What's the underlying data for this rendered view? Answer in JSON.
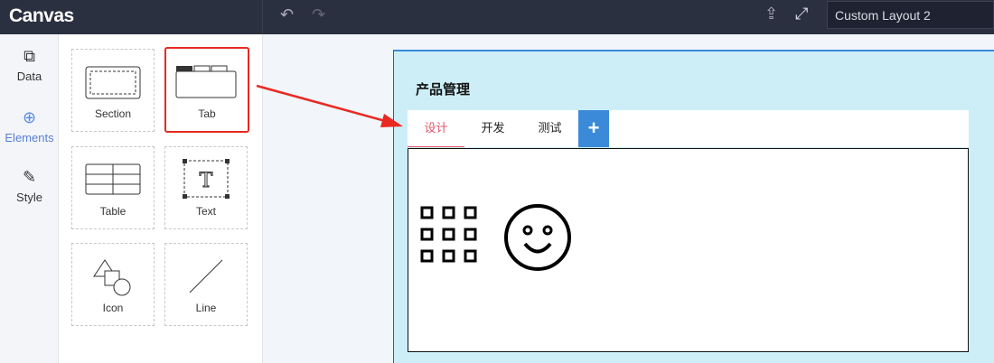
{
  "header": {
    "logo": "Canvas",
    "layout_name": "Custom Layout 2"
  },
  "rail": [
    {
      "label": "Data"
    },
    {
      "label": "Elements"
    },
    {
      "label": "Style"
    }
  ],
  "elements": [
    {
      "label": "Section"
    },
    {
      "label": "Tab"
    },
    {
      "label": "Table"
    },
    {
      "label": "Text"
    },
    {
      "label": "Icon"
    },
    {
      "label": "Line"
    }
  ],
  "canvas": {
    "title": "产品管理",
    "tabs": [
      {
        "label": "设计"
      },
      {
        "label": "开发"
      },
      {
        "label": "测试"
      }
    ],
    "add_label": "+"
  },
  "colors": {
    "accent": "#3a8ad9",
    "highlight": "#e82a22",
    "active_tab": "#e0556a"
  }
}
